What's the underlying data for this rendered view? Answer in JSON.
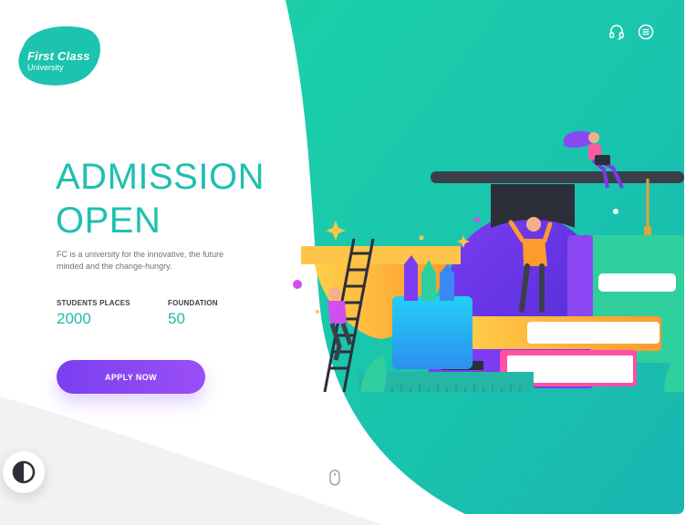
{
  "brand": {
    "name": "First Class",
    "subtitle": "University",
    "logo_color": "#1cc3ae"
  },
  "header": {
    "support_icon": "headset-icon",
    "menu_icon": "menu-icon"
  },
  "hero": {
    "title_line1": "ADMISSION",
    "title_line2": "OPEN",
    "description": "FC is a university for the innovative, the future minded and the change-hungry.",
    "title_color": "#1fc0b0"
  },
  "stats": [
    {
      "label": "STUDENTS PLACES",
      "value": "2000"
    },
    {
      "label": "FOUNDATION",
      "value": "50"
    }
  ],
  "cta": {
    "label": "APPLY NOW",
    "color": "#8544f3"
  },
  "controls": {
    "theme_toggle_icon": "contrast-icon",
    "scroll_icon": "mouse-scroll-icon"
  },
  "colors": {
    "teal": "#1cc8ac",
    "teal_dark": "#18b8a8",
    "purple": "#7b3ff0",
    "orange": "#ffb03a"
  }
}
